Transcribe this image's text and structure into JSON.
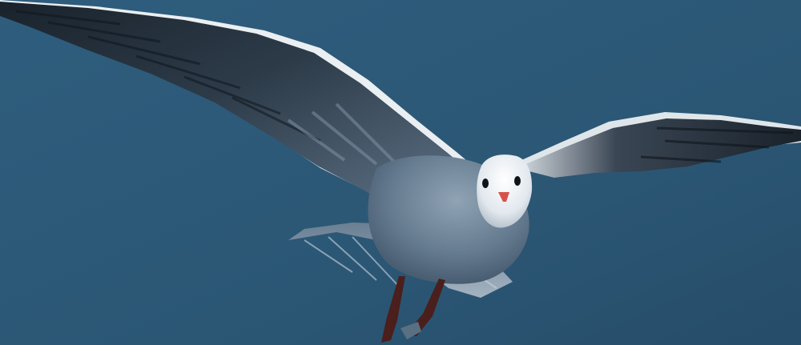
{
  "scene": {
    "subject": "gull",
    "colors": {
      "sky_deep": "#2b5775",
      "sky_light": "#3b6f93",
      "wing_dark": "#1c2630",
      "wing_mid": "#324150",
      "wing_light": "#5c7186",
      "body": "#6f8598",
      "head": "#e9eef2",
      "beak": "#d8504a",
      "legs": "#4a1f1c",
      "outline": "#ffffff"
    }
  }
}
